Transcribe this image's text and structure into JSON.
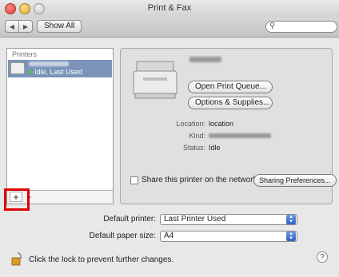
{
  "window": {
    "title": "Print & Fax"
  },
  "toolbar": {
    "show_all": "Show All",
    "back_icon": "back-arrow-icon",
    "forward_icon": "forward-arrow-icon",
    "search_icon": "magnifier-icon"
  },
  "printers_panel": {
    "header": "Printers",
    "items": [
      {
        "status": "Idle, Last Used"
      }
    ],
    "add_label": "+",
    "remove_label": "-"
  },
  "details": {
    "open_queue": "Open Print Queue...",
    "options_supplies": "Options & Supplies...",
    "location_label": "Location:",
    "location_value": "location",
    "kind_label": "Kind:",
    "status_label": "Status:",
    "status_value": "Idle",
    "share_label": "Share this printer on the network",
    "sharing_prefs": "Sharing Preferences..."
  },
  "defaults": {
    "printer_label": "Default printer:",
    "printer_value": "Last Printer Used",
    "paper_label": "Default paper size:",
    "paper_value": "A4"
  },
  "footer": {
    "lock_text": "Click the lock to prevent further changes.",
    "help_label": "?"
  },
  "colors": {
    "selection": "#7a93b8",
    "highlight": "#e00000",
    "select_arrows": "#3a6fd0"
  }
}
